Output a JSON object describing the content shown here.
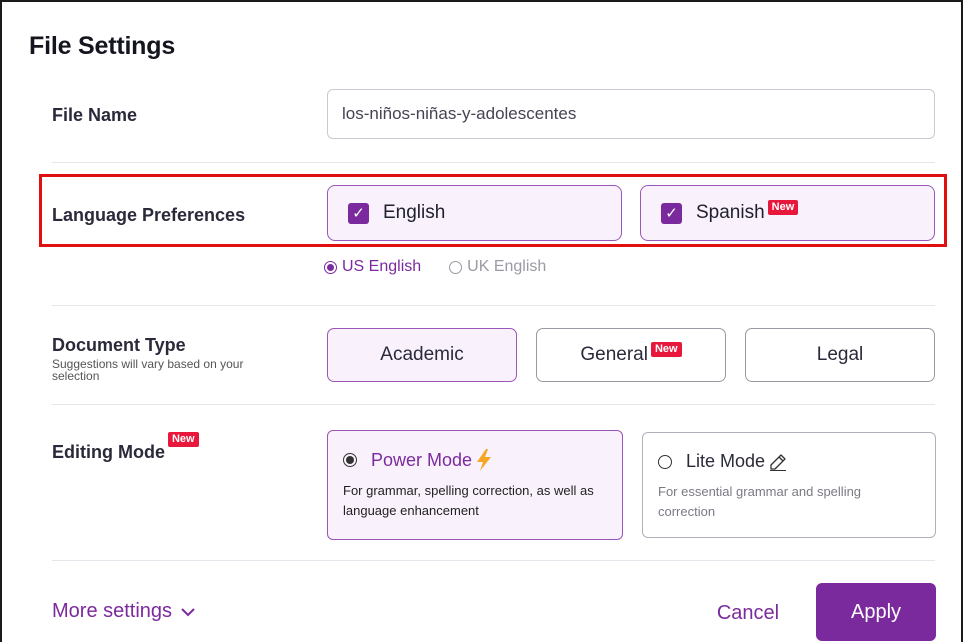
{
  "dialog": {
    "title": "File Settings"
  },
  "file_name": {
    "label": "File Name",
    "value": "los-niños-niñas-y-adolescentes"
  },
  "language": {
    "label": "Language Preferences",
    "options": [
      {
        "label": "English",
        "checked": true,
        "badge": ""
      },
      {
        "label": "Spanish",
        "checked": true,
        "badge": "New"
      }
    ],
    "dialects": [
      {
        "label": "US English",
        "selected": true
      },
      {
        "label": "UK English",
        "selected": false
      }
    ]
  },
  "document_type": {
    "label": "Document Type",
    "hint": "Suggestions will vary based on your selection",
    "options": [
      {
        "label": "Academic",
        "selected": true,
        "badge": ""
      },
      {
        "label": "General",
        "selected": false,
        "badge": "New"
      },
      {
        "label": "Legal",
        "selected": false,
        "badge": ""
      }
    ]
  },
  "editing_mode": {
    "label": "Editing Mode",
    "badge": "New",
    "modes": [
      {
        "title": "Power Mode",
        "icon": "lightning-icon",
        "selected": true,
        "description": "For grammar, spelling correction, as well as language enhancement"
      },
      {
        "title": "Lite Mode",
        "icon": "pencil-icon",
        "selected": false,
        "description": "For essential grammar and spelling correction"
      }
    ]
  },
  "footer": {
    "more_settings": "More settings",
    "cancel": "Cancel",
    "apply": "Apply"
  },
  "colors": {
    "accent": "#7b2a9e",
    "badge": "#e8183c",
    "highlight": "#e01010",
    "lightning": "#f5a623"
  }
}
